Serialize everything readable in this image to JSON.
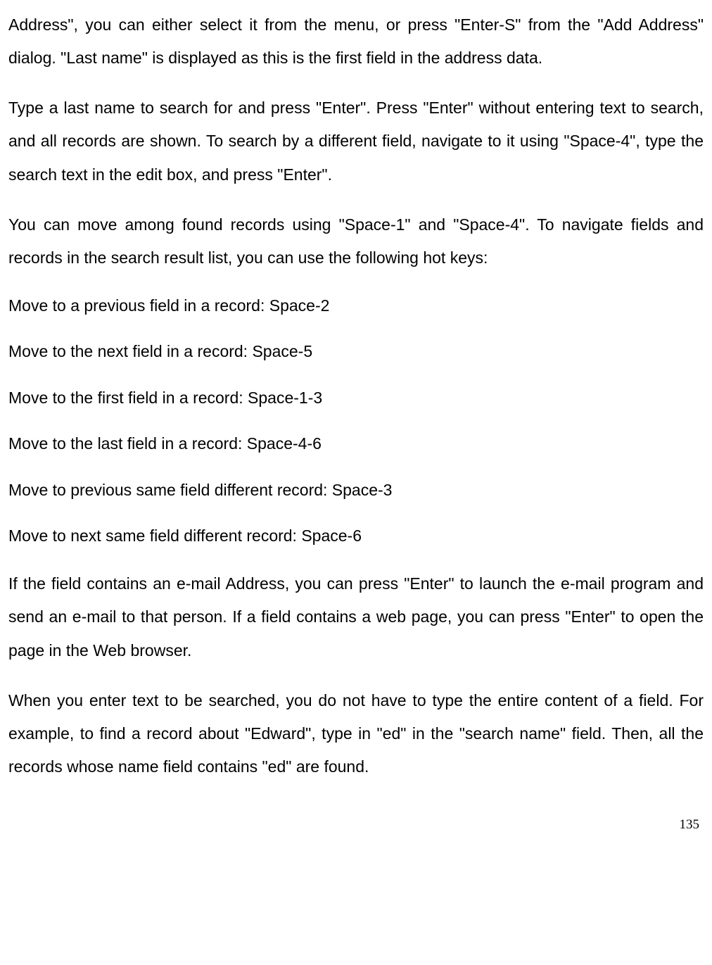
{
  "paragraphs": {
    "p1": "Address\", you can either select it from the menu, or press \"Enter-S\" from the \"Add Address\" dialog. \"Last name\" is displayed as this is the first field in the address data.",
    "p2": "Type a last name to search for and press \"Enter\". Press \"Enter\" without entering text to search, and all records are shown. To search by a different field, navigate to it using \"Space-4\", type the search text in the edit box, and press \"Enter\".",
    "p3": "You can move among found records using \"Space-1\" and \"Space-4\". To navigate fields and records in the search result list, you can use the following hot keys:",
    "h1": "Move to a previous field in a record: Space-2",
    "h2": "Move to the next field in a record: Space-5",
    "h3": "Move to the first field in a record: Space-1-3",
    "h4": "Move to the last field in a record: Space-4-6",
    "h5": "Move to previous same field different record: Space-3",
    "h6": "Move to next same field different record: Space-6",
    "p4": "If the field contains an e-mail Address, you can press \"Enter\" to launch the e-mail program and send an e-mail to that person. If a field contains a web page, you can press \"Enter\" to open the page in the Web browser.",
    "p5": "When you enter text to be searched, you do not have to type the entire content of a field. For example, to find a record about \"Edward\", type in \"ed\" in the \"search name\" field. Then, all the records whose name field contains \"ed\" are found."
  },
  "page_number": "135"
}
